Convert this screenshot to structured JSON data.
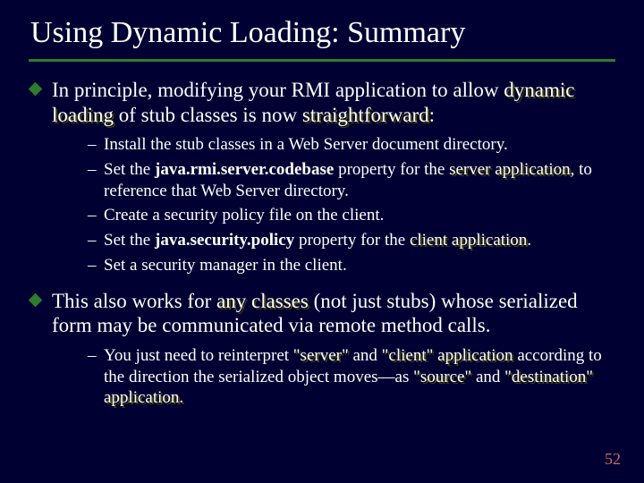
{
  "title": "Using Dynamic Loading: Summary",
  "p1": {
    "pre": "In principle, modifying your RMI application to allow ",
    "dyn": "dynamic loading",
    "post1": " of stub classes is now ",
    "sf": "straightforward",
    "post2": ":"
  },
  "s1": {
    "a": "Install the stub classes in a Web Server document directory."
  },
  "s2": {
    "pre": "Set the ",
    "b": "java.rmi.server.codebase",
    "mid": " property for the ",
    "srv": "server application",
    "post": ", to reference that Web Server directory."
  },
  "s3": {
    "a": "Create a security policy file on the client."
  },
  "s4": {
    "pre": "Set the ",
    "b": "java.security.policy",
    "mid": " property for the ",
    "cli": "client application",
    "post": "."
  },
  "s5": {
    "a": "Set a security manager in the client."
  },
  "p2": {
    "pre": "This also works for ",
    "any": "any classes",
    "post": " (not just stubs) whose serialized form may be communicated via remote method calls."
  },
  "s6": {
    "pre": "You just need to reinterpret ",
    "q1": "\"server\"",
    "and1": " and ",
    "q2": "\"client\"",
    "app": " application",
    "mid": " according to the direction the serialized object moves—as ",
    "q3": "\"source\"",
    "and2": " and ",
    "q4": "\"destination\"",
    "end": " application."
  },
  "page": "52"
}
